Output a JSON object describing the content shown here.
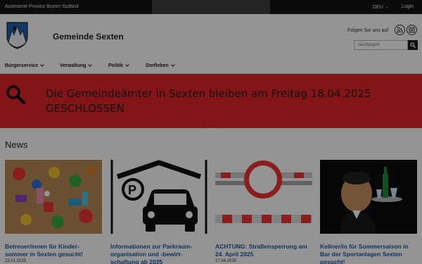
{
  "topbar": {
    "province": "Autonome Provinz Bozen Südtirol",
    "language": "DEU",
    "login": "Login"
  },
  "header": {
    "site_title": "Gemeinde Sexten",
    "follow_label": "Folgen Sie uns auf",
    "search_placeholder": "Suchbegriff"
  },
  "nav": {
    "items": [
      {
        "label": "Bürgerservice"
      },
      {
        "label": "Verwaltung"
      },
      {
        "label": "Politik"
      },
      {
        "label": "Dorfleben"
      }
    ]
  },
  "banner": {
    "message": "Die Gemeindeämter in Sexten bleiben am Freitag 18.04.2025 GESCHLOSSEN",
    "color": "#e2242a"
  },
  "news": {
    "heading": "News",
    "items": [
      {
        "title": "Betreuer/innen für Kinder-sommer in Sexten gesucht!",
        "date": "23.01.2025",
        "icon": "toys-photo"
      },
      {
        "title": "Informationen zur Parkraum-organisation und -bewirt-schaftung ab 2025",
        "date": "",
        "icon": "parking-garage-icon"
      },
      {
        "title": "ACHTUNG: Straßensperrung am 24. April 2025",
        "date": "17.04.2025",
        "icon": "road-closed-icon"
      },
      {
        "title": "Kellner/in für Sommersaison in Bar der Sportanlagen Sexten gesucht!",
        "date": "",
        "icon": "waiter-photo"
      }
    ]
  },
  "colors": {
    "topbar": "#141414",
    "link": "#1a5aa0",
    "overlay": "rgba(0,0,0,0.42)"
  }
}
